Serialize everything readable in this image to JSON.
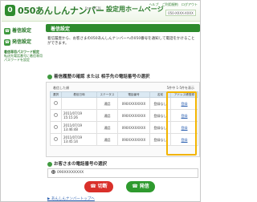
{
  "header": {
    "logo_glyph": "0",
    "brand": "050あんしんナンバー",
    "brand_sub": "for OCN",
    "title": "設定用ホームページ",
    "top_links": [
      "ヘルプ",
      "ご利用規約",
      "ログアウト"
    ],
    "number_value": "050-XXXX-XXXX"
  },
  "sidebar": {
    "items": [
      {
        "label": "着信設定",
        "icon": "phone-in-icon"
      },
      {
        "label": "発信設定",
        "icon": "phone-out-icon"
      }
    ],
    "note_title": "着信専用パスワード設定",
    "note_body": "転送先電話番号に着信専用パスワードを設定"
  },
  "main": {
    "page_title": "着信設定",
    "intro": "着信履歴から、お客さまの050あんしんナンバーへの050番号を通知して電話をかけることができます。",
    "section1": "着信履歴の確認 または 相手先の電話番号の選択",
    "sort_label": "着信した順",
    "count_text": "5件中 1-5件を表示",
    "columns": [
      "選択",
      "着信日時",
      "ステータス",
      "電話番号",
      "名前",
      "アドレス帳登録"
    ],
    "rows": [
      {
        "date": "",
        "status": "通話",
        "number": "090XXXXXXXX",
        "name": "登録なし",
        "action": "登録"
      },
      {
        "date": "2011/07/19 15:15:26",
        "status": "通話",
        "number": "090XXXXXXXX",
        "name": "登録なし",
        "action": "登録"
      },
      {
        "date": "2011/07/19 13:46:48",
        "status": "通話",
        "number": "090XXXXXXXX",
        "name": "登録なし",
        "action": "登録"
      },
      {
        "date": "2011/07/19 13:45:14",
        "status": "通話",
        "number": "090XXXXXXXX",
        "name": "登録なし",
        "action": "登録"
      }
    ],
    "section2": "お客さまの電話番号の選択",
    "phone_value": "090XXXXXXXX",
    "cut_button": "切断",
    "send_button": "発信",
    "bottom_link": "あんしんナンバートップへ"
  },
  "colors": {
    "brand_green": "#2e8b2e",
    "highlight": "#f2b400",
    "cut_red": "#d9302a"
  }
}
